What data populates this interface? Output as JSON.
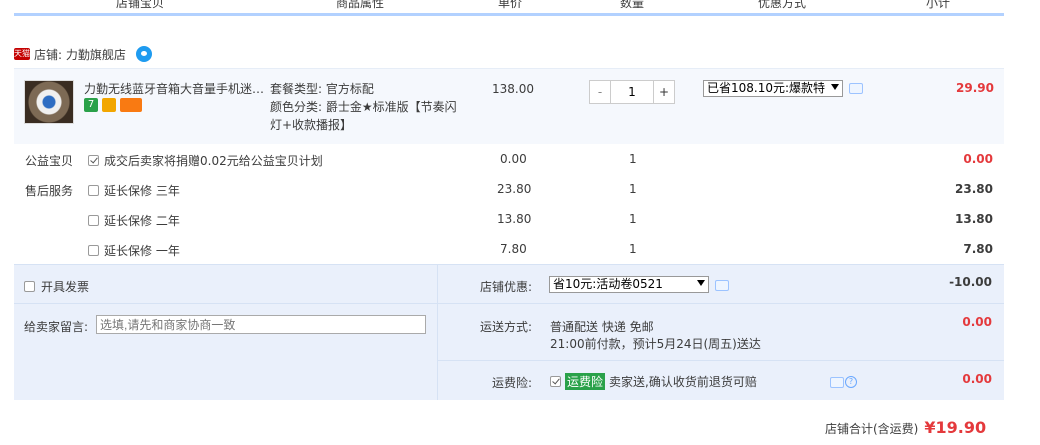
{
  "columns": [
    "店铺宝贝",
    "商品属性",
    "单价",
    "数量",
    "优惠方式",
    "小计"
  ],
  "shop": {
    "badge": "天猫",
    "name": "店铺: 力勤旗舰店"
  },
  "item": {
    "title": "力勤无线蓝牙音箱大音量手机迷…",
    "attr_package": "套餐类型: 官方标配",
    "attr_color": "颜色分类: 爵士金★标准版【节奏闪灯+收款播报】",
    "price": "138.00",
    "qty": "1",
    "qty_minus": "-",
    "qty_plus": "+",
    "promo": "已省108.10元:爆款特",
    "subtotal": "29.90",
    "badges": [
      "7",
      "",
      ""
    ]
  },
  "charity": {
    "label": "公益宝贝",
    "text": "成交后卖家将捐赠0.02元给公益宝贝计划",
    "price": "0.00",
    "qty": "1",
    "subtotal": "0.00"
  },
  "after_sale": {
    "label": "售后服务",
    "options": [
      {
        "text": "延长保修 三年",
        "price": "23.80",
        "qty": "1",
        "subtotal": "23.80"
      },
      {
        "text": "延长保修 二年",
        "price": "13.80",
        "qty": "1",
        "subtotal": "13.80"
      },
      {
        "text": "延长保修 一年",
        "price": "7.80",
        "qty": "1",
        "subtotal": "7.80"
      }
    ]
  },
  "invoice": {
    "label": "开具发票"
  },
  "message": {
    "label": "给卖家留言:",
    "placeholder": "选填,请先和商家协商一致"
  },
  "shop_discount": {
    "label": "店铺优惠:",
    "value": "省10元:活动卷0521",
    "amount": "-10.00"
  },
  "shipping": {
    "label": "运送方式:",
    "method": "普通配送 快递 免邮",
    "eta": "21:00前付款，预计5月24日(周五)送达",
    "amount": "0.00"
  },
  "freight_insurance": {
    "label": "运费险:",
    "tag": "运费险",
    "text": "卖家送,确认收货前退货可赔",
    "amount": "0.00"
  },
  "total": {
    "label": "店铺合计(含运费)",
    "amount": "¥19.90"
  },
  "colors": {
    "accent_red": "#e4393c",
    "header_line": "#b2d1ff",
    "bottom_bg": "#eaf0fb"
  }
}
